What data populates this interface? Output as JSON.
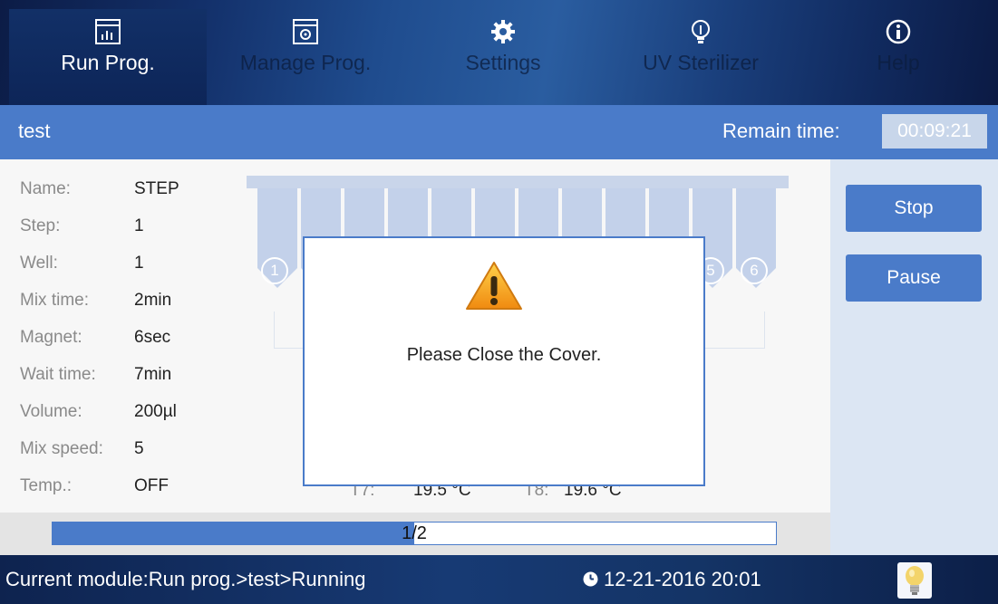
{
  "nav": {
    "tabs": [
      {
        "label": "Run Prog.",
        "icon": "chart-icon",
        "active": true
      },
      {
        "label": "Manage Prog.",
        "icon": "manage-icon"
      },
      {
        "label": "Settings",
        "icon": "gear-icon"
      },
      {
        "label": "UV Sterilizer",
        "icon": "bulb-icon"
      },
      {
        "label": "Help",
        "icon": "info-icon"
      }
    ]
  },
  "header": {
    "program": "test",
    "remain_label": "Remain time:",
    "remain_value": "00:09:21"
  },
  "params": [
    {
      "label": "Name:",
      "value": "STEP"
    },
    {
      "label": "Step:",
      "value": "1"
    },
    {
      "label": "Well:",
      "value": "1"
    },
    {
      "label": "Mix time:",
      "value": "2min"
    },
    {
      "label": "Magnet:",
      "value": "6sec"
    },
    {
      "label": "Wait time:",
      "value": "7min"
    },
    {
      "label": "Volume:",
      "value": "200µl"
    },
    {
      "label": "Mix speed:",
      "value": "5"
    },
    {
      "label": "Temp.:",
      "value": "OFF"
    }
  ],
  "wells": {
    "visible_numbers": [
      "1",
      "5",
      "6"
    ]
  },
  "temps": [
    {
      "label": "T7:",
      "value": "19.5 °C"
    },
    {
      "label": "T8:",
      "value": "19.6 °C"
    }
  ],
  "progress": {
    "text": "1/2",
    "fraction": 0.5
  },
  "actions": {
    "stop": "Stop",
    "pause": "Pause"
  },
  "dialog": {
    "message": "Please Close the Cover."
  },
  "status": {
    "module": "Current module:Run prog.>test>Running",
    "datetime": "12-21-2016 20:01"
  },
  "colors": {
    "accent": "#4a7bc9",
    "warning": "#f0a020",
    "nav_dark": "#0d2558"
  }
}
